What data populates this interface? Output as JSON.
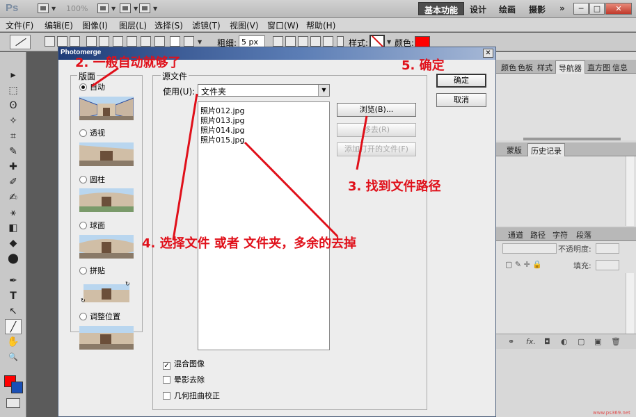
{
  "app": {
    "logo": "Ps",
    "zoom": "100%"
  },
  "workspace": {
    "basic": "基本功能",
    "design": "设计",
    "paint": "绘画",
    "photo": "摄影",
    "more": "»"
  },
  "window_controls": {
    "min": "─",
    "max": "□",
    "close": "✕"
  },
  "menu": [
    "文件(F)",
    "编辑(E)",
    "图像(I)",
    "图层(L)",
    "选择(S)",
    "滤镜(T)",
    "视图(V)",
    "窗口(W)",
    "帮助(H)"
  ],
  "options": {
    "weight_label": "粗细:",
    "weight_value": "5 px",
    "style_label": "样式:",
    "color_label": "颜色:",
    "color": "#ff0000"
  },
  "tools": [
    "▸",
    "⬚",
    "ʘ",
    "✧",
    "⌗",
    "✎",
    "✚",
    "✐",
    "✍",
    "⚹",
    "◧",
    "◆",
    "⬤",
    "✒",
    "T",
    "↖",
    "╱",
    "✋",
    "🔍"
  ],
  "colors": {
    "foreground": "#ff0000",
    "background": "#1a4fb5"
  },
  "panels": {
    "tabs_top": [
      "颜色",
      "色板",
      "样式",
      "导航器",
      "直方图",
      "信息"
    ],
    "tabs_mid": [
      "蒙版",
      "历史记录"
    ],
    "tabs_layers": [
      "通道",
      "路径",
      "字符",
      "段落"
    ],
    "opacity_label": "不透明度:",
    "fill_label": "填充:",
    "footer_icons": [
      "⚭",
      "fx.",
      "◘",
      "◐",
      "▢",
      "▣",
      "🗑"
    ]
  },
  "dialog": {
    "title": "Photomerge",
    "close": "✕",
    "layout_group": "版面",
    "layouts": [
      {
        "label": "自动",
        "selected": true
      },
      {
        "label": "透视",
        "selected": false
      },
      {
        "label": "圆柱",
        "selected": false
      },
      {
        "label": "球面",
        "selected": false
      },
      {
        "label": "拼贴",
        "selected": false
      },
      {
        "label": "调整位置",
        "selected": false
      }
    ],
    "source_group": "源文件",
    "use_label": "使用(U):",
    "use_value": "文件夹",
    "files": [
      "照片012.jpg",
      "照片013.jpg",
      "照片014.jpg",
      "照片015.jpg"
    ],
    "buttons": {
      "browse": "浏览(B)...",
      "remove": "移去(R)",
      "add_open": "添加打开的文件(F)",
      "ok": "确定",
      "cancel": "取消"
    },
    "checkboxes": [
      {
        "label": "混合图像",
        "checked": true
      },
      {
        "label": "晕影去除",
        "checked": false
      },
      {
        "label": "几何扭曲校正",
        "checked": false
      }
    ]
  },
  "annotations": {
    "a2": "2. 一般自动就够了",
    "a5": "5. 确定",
    "a3": "3. 找到文件路径",
    "a4": "4. 选择文件  或者  文件夹，多余的去掉"
  },
  "watermark": "www.ps369.net"
}
